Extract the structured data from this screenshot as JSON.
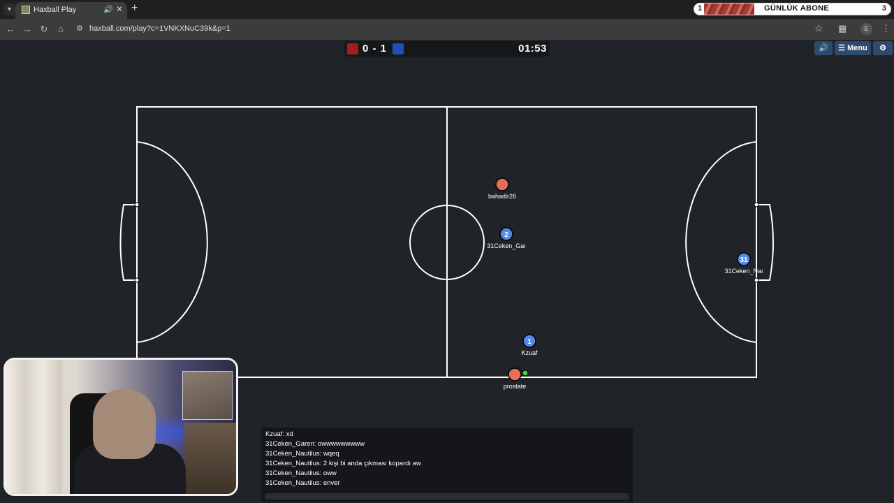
{
  "browser": {
    "tab_title": "Haxball Play",
    "new_tab_icon": "plus-icon",
    "url": "haxball.com/play?c=1VNKXNuC39k&p=1",
    "extension_banner": {
      "left_value": "1",
      "title": "GÜNLÜK ABONE",
      "right_value": "3"
    },
    "profile_initial": "E"
  },
  "game": {
    "score": "0 - 1",
    "timer": "01:53",
    "colors": {
      "red": "#a51c1c",
      "blue": "#1d4fb5",
      "pitch_bg": "#202428",
      "line": "#ffffff"
    },
    "buttons": {
      "sound_icon": "speaker-icon",
      "menu_label": "Menu",
      "settings_icon": "gear-icon"
    },
    "players": [
      {
        "name": "bahadir26",
        "team": "red",
        "number": ""
      },
      {
        "name": "31Ceken_Gaı",
        "team": "blue",
        "number": "2"
      },
      {
        "name": "31Ceken_Naı",
        "team": "blue",
        "number": "31"
      },
      {
        "name": "Kzuaf",
        "team": "blue",
        "number": "1"
      },
      {
        "name": "prostate",
        "team": "red",
        "number": ""
      }
    ]
  },
  "chat": {
    "messages": [
      "Kzuaf: xd",
      "31Ceken_Garen: owwwwwwwww",
      "31Ceken_Nautilus: wqeq",
      "31Ceken_Nautilus: 2 kişi bi anda çıkması kopardı aw",
      "31Ceken_Nautilus: oww",
      "31Ceken_Nautilus: enver"
    ]
  }
}
